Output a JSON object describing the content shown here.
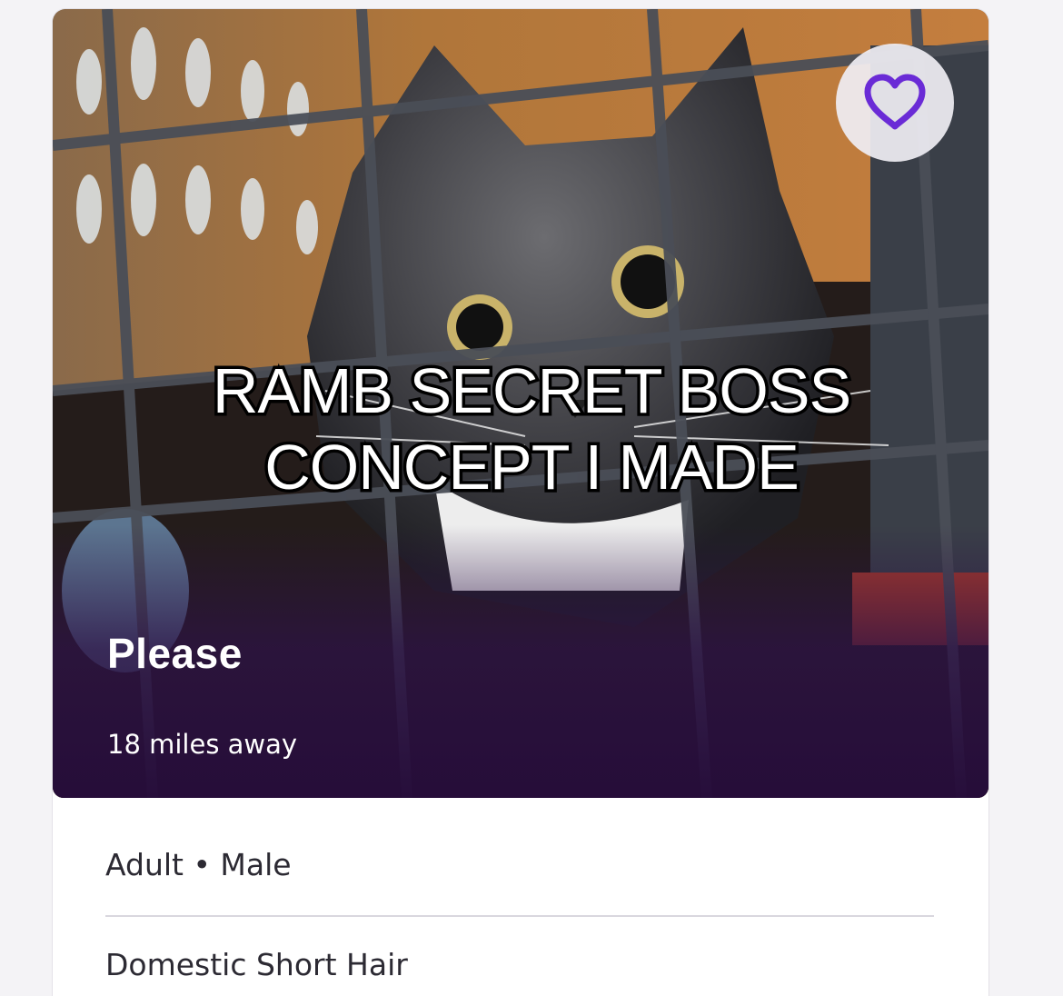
{
  "overlay_caption": {
    "line1": "RAMB SECRET BOSS",
    "line2": "CONCEPT I MADE"
  },
  "pet_card": {
    "name": "Please",
    "distance": "18 miles away",
    "favorite_icon": "heart-outline-icon",
    "accent_color": "#6a2bd6",
    "details": {
      "age_gender": "Adult • Male",
      "breed": "Domestic Short Hair"
    }
  }
}
